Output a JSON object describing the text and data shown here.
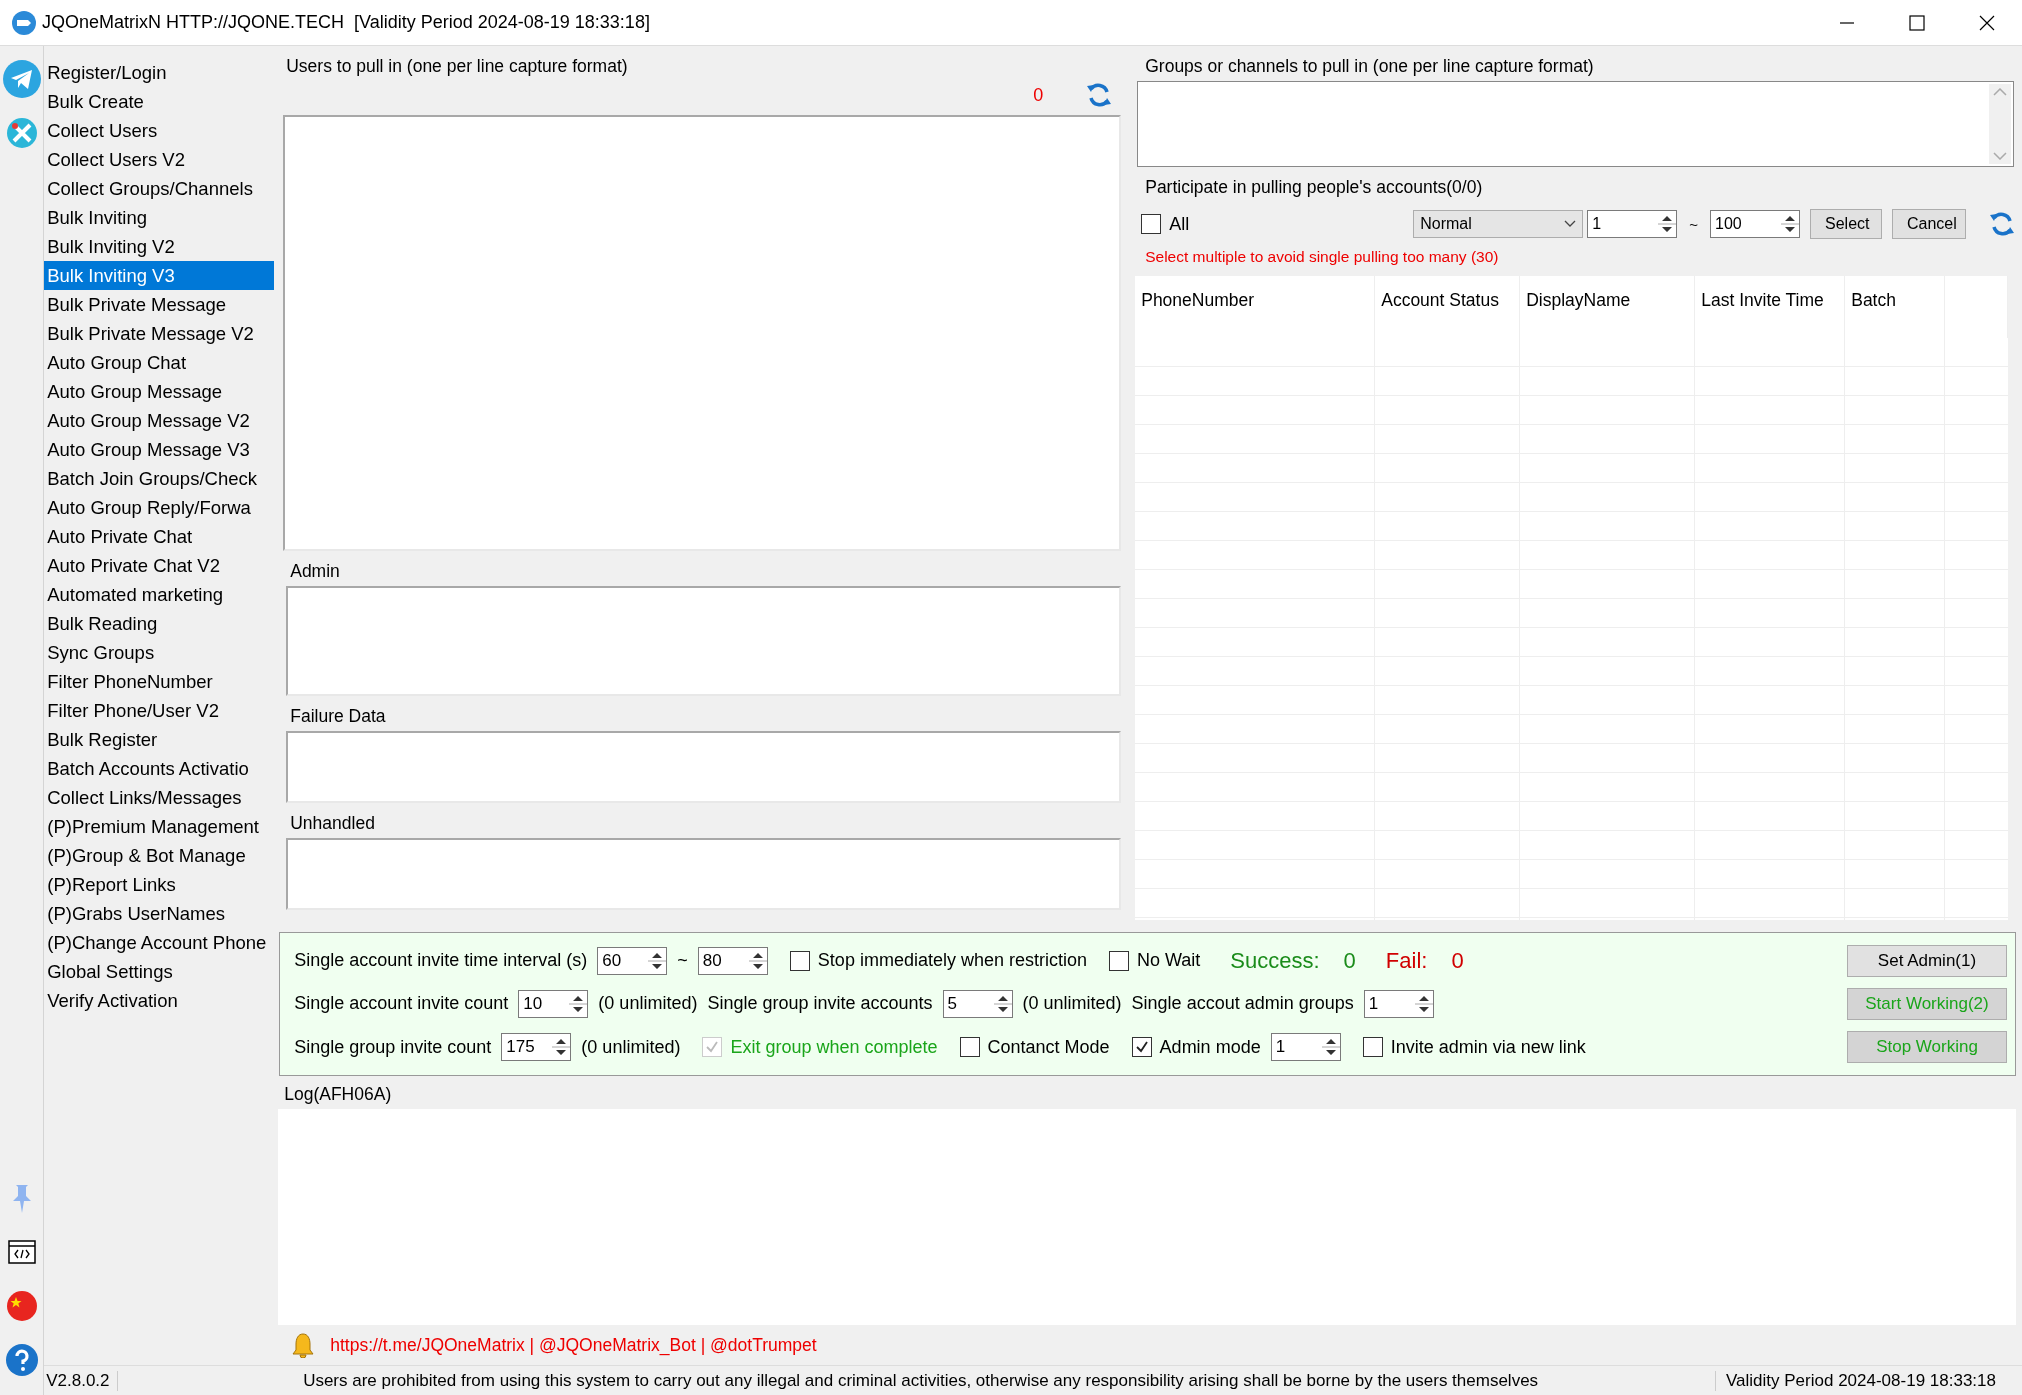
{
  "window": {
    "title": "JQOneMatrixN HTTP://JQONE.TECH  [Validity Period 2024-08-19 18:33:18]"
  },
  "sidebar": {
    "items": [
      {
        "label": "Register/Login",
        "selected": false
      },
      {
        "label": "Bulk Create",
        "selected": false
      },
      {
        "label": "Collect Users",
        "selected": false
      },
      {
        "label": "Collect Users V2",
        "selected": false
      },
      {
        "label": "Collect Groups/Channels",
        "selected": false
      },
      {
        "label": "Bulk Inviting",
        "selected": false
      },
      {
        "label": "Bulk Inviting V2",
        "selected": false
      },
      {
        "label": "Bulk Inviting V3",
        "selected": true
      },
      {
        "label": "Bulk Private Message",
        "selected": false
      },
      {
        "label": "Bulk Private Message V2",
        "selected": false
      },
      {
        "label": "Auto Group Chat",
        "selected": false
      },
      {
        "label": "Auto Group Message",
        "selected": false
      },
      {
        "label": "Auto Group Message V2",
        "selected": false
      },
      {
        "label": "Auto Group Message V3",
        "selected": false
      },
      {
        "label": "Batch Join Groups/Check",
        "selected": false
      },
      {
        "label": "Auto Group Reply/Forwa",
        "selected": false
      },
      {
        "label": "Auto Private Chat",
        "selected": false
      },
      {
        "label": "Auto Private Chat V2",
        "selected": false
      },
      {
        "label": "Automated marketing",
        "selected": false
      },
      {
        "label": "Bulk Reading",
        "selected": false
      },
      {
        "label": "Sync Groups",
        "selected": false
      },
      {
        "label": "Filter PhoneNumber",
        "selected": false
      },
      {
        "label": "Filter Phone/User V2",
        "selected": false
      },
      {
        "label": "Bulk Register",
        "selected": false
      },
      {
        "label": "Batch Accounts Activatio",
        "selected": false
      },
      {
        "label": "Collect Links/Messages",
        "selected": false
      },
      {
        "label": "(P)Premium Management",
        "selected": false
      },
      {
        "label": "(P)Group & Bot Manage",
        "selected": false
      },
      {
        "label": "(P)Report Links",
        "selected": false
      },
      {
        "label": "(P)Grabs UserNames",
        "selected": false
      },
      {
        "label": "(P)Change Account Phone",
        "selected": false
      },
      {
        "label": "Global Settings",
        "selected": false
      },
      {
        "label": "Verify Activation",
        "selected": false
      }
    ]
  },
  "users_group": {
    "title": "Users to pull in (one per line capture format)",
    "count": "0"
  },
  "text_groups": [
    {
      "title": "Admin"
    },
    {
      "title": "Failure Data"
    },
    {
      "title": "Unhandled"
    }
  ],
  "groups_box": {
    "title": "Groups or channels to pull in (one per line capture format)"
  },
  "accounts": {
    "title": "Participate in pulling people's accounts(0/0)",
    "all": {
      "label": "All",
      "checked": false
    },
    "mode": "Normal",
    "from": "1",
    "separator": "~",
    "to": "100",
    "buttons": [
      "Select",
      "Cancel"
    ],
    "hint": "Select multiple to avoid single pulling too many (30)"
  },
  "table": {
    "columns": [
      "PhoneNumber",
      "Account Status",
      "DisplayName",
      "Last Invite Time",
      "Batch"
    ]
  },
  "settings": {
    "lines": [
      {
        "items": [
          {
            "kind": "label",
            "text": "Single account invite time interval (s)"
          },
          {
            "kind": "spin",
            "value": "60"
          },
          {
            "kind": "note",
            "text": "~"
          },
          {
            "kind": "spin",
            "value": "80"
          },
          {
            "kind": "check",
            "text": "Stop immediately when restriction",
            "checked": false,
            "disabled": false
          },
          {
            "kind": "check",
            "text": "No Wait",
            "checked": false,
            "disabled": false
          },
          {
            "kind": "success",
            "text": "Success:",
            "value": "0"
          },
          {
            "kind": "fail",
            "text": "Fail:",
            "value": "0"
          }
        ]
      },
      {
        "items": [
          {
            "kind": "label",
            "text": "Single account invite count"
          },
          {
            "kind": "spin",
            "value": "10"
          },
          {
            "kind": "note",
            "text": "(0 unlimited)"
          },
          {
            "kind": "label",
            "text": "Single group invite accounts"
          },
          {
            "kind": "spin",
            "value": "5"
          },
          {
            "kind": "note",
            "text": "(0 unlimited)"
          },
          {
            "kind": "label",
            "text": "Single accout admin groups"
          },
          {
            "kind": "spin",
            "value": "1"
          }
        ]
      },
      {
        "items": [
          {
            "kind": "label",
            "text": "Single group invite count"
          },
          {
            "kind": "spin",
            "value": "175"
          },
          {
            "kind": "note",
            "text": "(0 unlimited)"
          },
          {
            "kind": "check",
            "text": "Exit group when complete",
            "checked": true,
            "disabled": true
          },
          {
            "kind": "check",
            "text": "Contanct Mode",
            "checked": false,
            "disabled": false
          },
          {
            "kind": "check",
            "text": "Admin mode",
            "checked": true,
            "disabled": false
          },
          {
            "kind": "spin",
            "value": "1"
          },
          {
            "kind": "check",
            "text": "Invite admin via new link",
            "checked": false,
            "disabled": false
          }
        ]
      }
    ],
    "buttons": [
      {
        "label": "Set Admin(1)",
        "kind": "plain"
      },
      {
        "label": "Start Working(2)",
        "kind": "accent"
      },
      {
        "label": "Stop Working",
        "kind": "accent"
      }
    ]
  },
  "log": {
    "title": "Log(AFH06A)"
  },
  "contact": "https://t.me/JQOneMatrix | @JQOneMatrix_Bot | @dotTrumpet",
  "status_bar": {
    "version": "V2.8.0.2",
    "notice": "Users are prohibited from using this system to carry out any illegal and criminal activities, otherwise any responsibility arising shall be borne by the users themselves",
    "validity": "Validity Period 2024-08-19 18:33:18"
  }
}
